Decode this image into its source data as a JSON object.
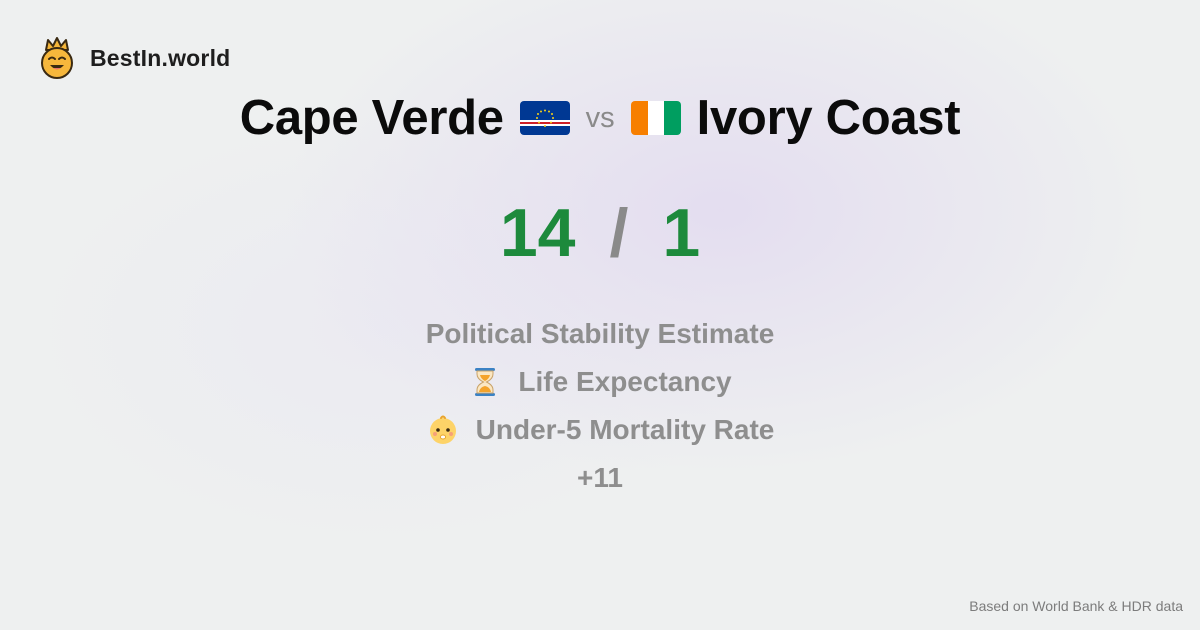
{
  "brand": {
    "name": "BestIn.world",
    "logo_icon": "crown-smiley-icon"
  },
  "comparison": {
    "country_a": "Cape Verde",
    "country_a_flag": "cape-verde-flag-icon",
    "vs_label": "vs",
    "country_b": "Ivory Coast",
    "country_b_flag": "ivory-coast-flag-icon"
  },
  "score": {
    "a": "14",
    "separator": "/",
    "b": "1",
    "color": "#1d8a3c"
  },
  "metrics": [
    {
      "label": "Political Stability Estimate",
      "icon": ""
    },
    {
      "label": "Life Expectancy",
      "icon": "hourglass-icon"
    },
    {
      "label": "Under-5 Mortality Rate",
      "icon": "baby-icon"
    },
    {
      "label": "+11",
      "icon": ""
    }
  ],
  "footer": {
    "source": "Based on World Bank & HDR data"
  }
}
